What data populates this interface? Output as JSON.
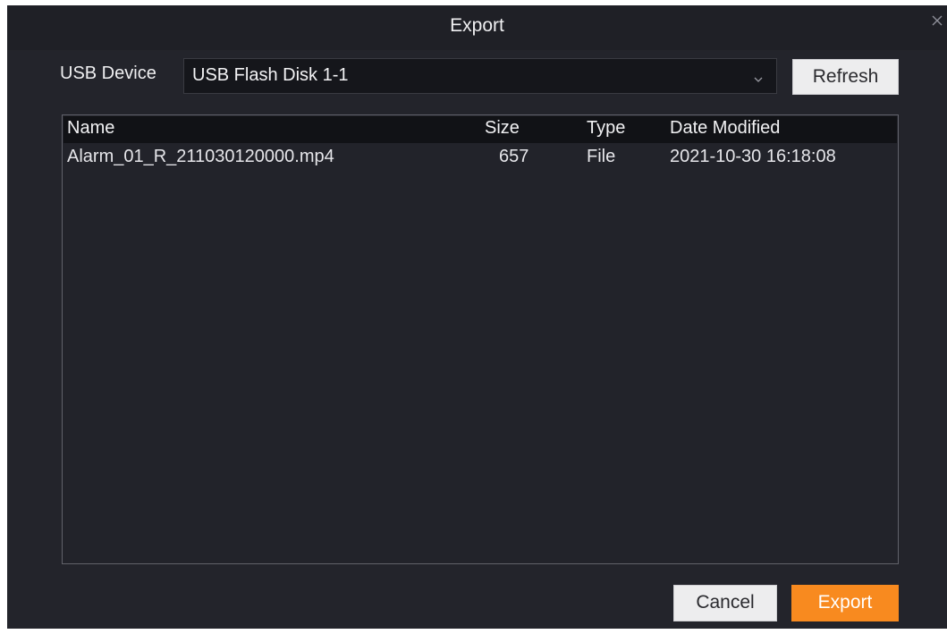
{
  "dialog": {
    "title": "Export"
  },
  "usb": {
    "label": "USB Device",
    "selected": "USB Flash Disk 1-1",
    "refresh_label": "Refresh"
  },
  "table": {
    "columns": [
      "Name",
      "Size",
      "Type",
      "Date Modified"
    ],
    "rows": [
      {
        "name": "Alarm_01_R_211030120000.mp4",
        "size": "657",
        "type": "File",
        "date": "2021-10-30 16:18:08"
      }
    ]
  },
  "footer": {
    "cancel_label": "Cancel",
    "export_label": "Export"
  },
  "colors": {
    "accent": "#f88a1f",
    "background": "#23242b",
    "header": "#111216"
  },
  "icons": {
    "close": "close-icon",
    "dropdown": "chevron-down-icon"
  }
}
